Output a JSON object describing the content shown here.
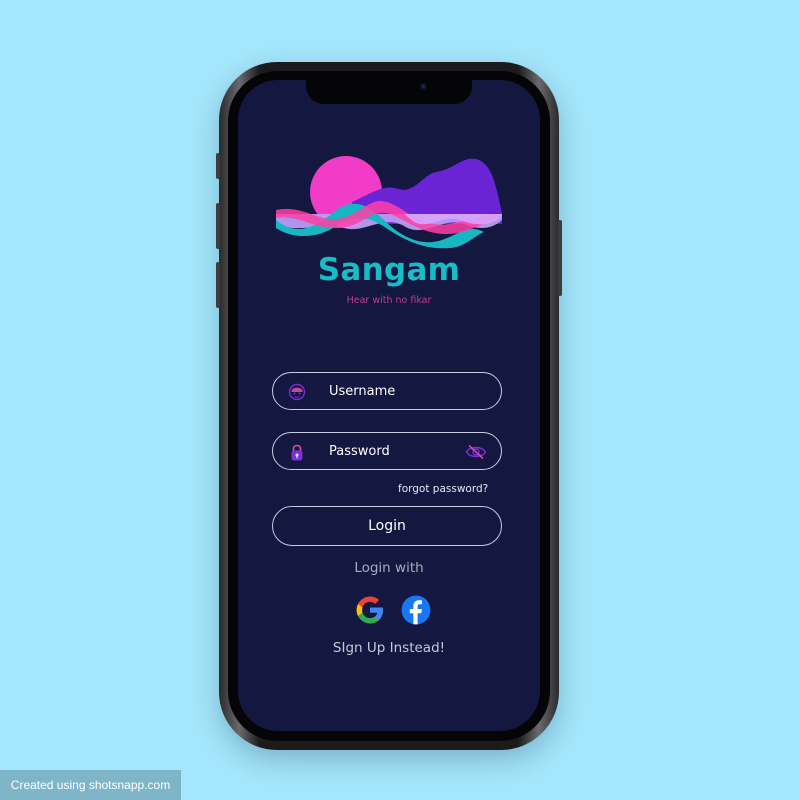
{
  "app": {
    "name": "Sangam",
    "tagline": "Hear with no fikar"
  },
  "login_form": {
    "username_placeholder": "Username",
    "password_placeholder": "Password",
    "forgot_password_link": "forgot password?",
    "login_button": "Login",
    "login_with_label": "Login with",
    "social_providers": [
      "google",
      "facebook"
    ],
    "signup_link": "SIgn Up Instead!"
  },
  "icons": {
    "username": "user-icon",
    "password": "lock-icon",
    "password_visibility": "eye-slash-icon",
    "google": "google-icon",
    "facebook": "facebook-icon"
  },
  "colors": {
    "page_background": "#a4e6fb",
    "screen_background": "#14173f",
    "brand_teal": "#17bcc6",
    "tagline_pink": "#c23a9a",
    "accent_purple": "#7b2fd8",
    "facebook_blue": "#1877f2"
  },
  "watermark": "Created using shotsnapp.com"
}
